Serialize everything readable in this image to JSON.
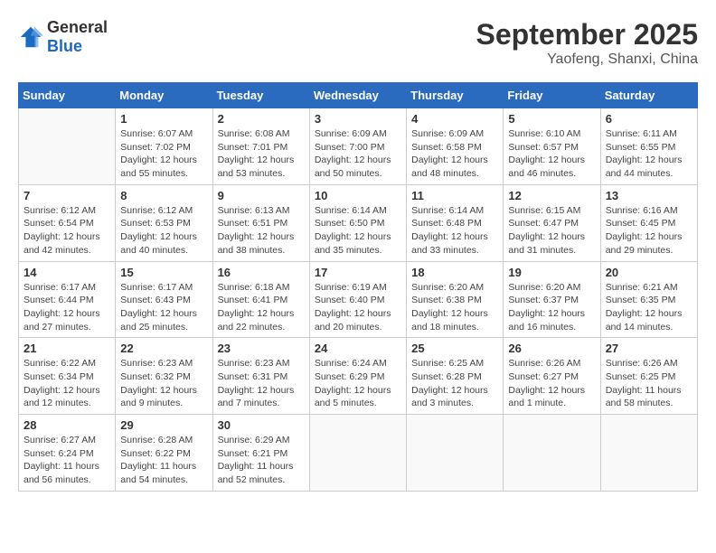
{
  "header": {
    "logo_general": "General",
    "logo_blue": "Blue",
    "month_title": "September 2025",
    "location": "Yaofeng, Shanxi, China"
  },
  "days_of_week": [
    "Sunday",
    "Monday",
    "Tuesday",
    "Wednesday",
    "Thursday",
    "Friday",
    "Saturday"
  ],
  "weeks": [
    [
      {
        "day": "",
        "info": ""
      },
      {
        "day": "1",
        "info": "Sunrise: 6:07 AM\nSunset: 7:02 PM\nDaylight: 12 hours\nand 55 minutes."
      },
      {
        "day": "2",
        "info": "Sunrise: 6:08 AM\nSunset: 7:01 PM\nDaylight: 12 hours\nand 53 minutes."
      },
      {
        "day": "3",
        "info": "Sunrise: 6:09 AM\nSunset: 7:00 PM\nDaylight: 12 hours\nand 50 minutes."
      },
      {
        "day": "4",
        "info": "Sunrise: 6:09 AM\nSunset: 6:58 PM\nDaylight: 12 hours\nand 48 minutes."
      },
      {
        "day": "5",
        "info": "Sunrise: 6:10 AM\nSunset: 6:57 PM\nDaylight: 12 hours\nand 46 minutes."
      },
      {
        "day": "6",
        "info": "Sunrise: 6:11 AM\nSunset: 6:55 PM\nDaylight: 12 hours\nand 44 minutes."
      }
    ],
    [
      {
        "day": "7",
        "info": "Sunrise: 6:12 AM\nSunset: 6:54 PM\nDaylight: 12 hours\nand 42 minutes."
      },
      {
        "day": "8",
        "info": "Sunrise: 6:12 AM\nSunset: 6:53 PM\nDaylight: 12 hours\nand 40 minutes."
      },
      {
        "day": "9",
        "info": "Sunrise: 6:13 AM\nSunset: 6:51 PM\nDaylight: 12 hours\nand 38 minutes."
      },
      {
        "day": "10",
        "info": "Sunrise: 6:14 AM\nSunset: 6:50 PM\nDaylight: 12 hours\nand 35 minutes."
      },
      {
        "day": "11",
        "info": "Sunrise: 6:14 AM\nSunset: 6:48 PM\nDaylight: 12 hours\nand 33 minutes."
      },
      {
        "day": "12",
        "info": "Sunrise: 6:15 AM\nSunset: 6:47 PM\nDaylight: 12 hours\nand 31 minutes."
      },
      {
        "day": "13",
        "info": "Sunrise: 6:16 AM\nSunset: 6:45 PM\nDaylight: 12 hours\nand 29 minutes."
      }
    ],
    [
      {
        "day": "14",
        "info": "Sunrise: 6:17 AM\nSunset: 6:44 PM\nDaylight: 12 hours\nand 27 minutes."
      },
      {
        "day": "15",
        "info": "Sunrise: 6:17 AM\nSunset: 6:43 PM\nDaylight: 12 hours\nand 25 minutes."
      },
      {
        "day": "16",
        "info": "Sunrise: 6:18 AM\nSunset: 6:41 PM\nDaylight: 12 hours\nand 22 minutes."
      },
      {
        "day": "17",
        "info": "Sunrise: 6:19 AM\nSunset: 6:40 PM\nDaylight: 12 hours\nand 20 minutes."
      },
      {
        "day": "18",
        "info": "Sunrise: 6:20 AM\nSunset: 6:38 PM\nDaylight: 12 hours\nand 18 minutes."
      },
      {
        "day": "19",
        "info": "Sunrise: 6:20 AM\nSunset: 6:37 PM\nDaylight: 12 hours\nand 16 minutes."
      },
      {
        "day": "20",
        "info": "Sunrise: 6:21 AM\nSunset: 6:35 PM\nDaylight: 12 hours\nand 14 minutes."
      }
    ],
    [
      {
        "day": "21",
        "info": "Sunrise: 6:22 AM\nSunset: 6:34 PM\nDaylight: 12 hours\nand 12 minutes."
      },
      {
        "day": "22",
        "info": "Sunrise: 6:23 AM\nSunset: 6:32 PM\nDaylight: 12 hours\nand 9 minutes."
      },
      {
        "day": "23",
        "info": "Sunrise: 6:23 AM\nSunset: 6:31 PM\nDaylight: 12 hours\nand 7 minutes."
      },
      {
        "day": "24",
        "info": "Sunrise: 6:24 AM\nSunset: 6:29 PM\nDaylight: 12 hours\nand 5 minutes."
      },
      {
        "day": "25",
        "info": "Sunrise: 6:25 AM\nSunset: 6:28 PM\nDaylight: 12 hours\nand 3 minutes."
      },
      {
        "day": "26",
        "info": "Sunrise: 6:26 AM\nSunset: 6:27 PM\nDaylight: 12 hours\nand 1 minute."
      },
      {
        "day": "27",
        "info": "Sunrise: 6:26 AM\nSunset: 6:25 PM\nDaylight: 11 hours\nand 58 minutes."
      }
    ],
    [
      {
        "day": "28",
        "info": "Sunrise: 6:27 AM\nSunset: 6:24 PM\nDaylight: 11 hours\nand 56 minutes."
      },
      {
        "day": "29",
        "info": "Sunrise: 6:28 AM\nSunset: 6:22 PM\nDaylight: 11 hours\nand 54 minutes."
      },
      {
        "day": "30",
        "info": "Sunrise: 6:29 AM\nSunset: 6:21 PM\nDaylight: 11 hours\nand 52 minutes."
      },
      {
        "day": "",
        "info": ""
      },
      {
        "day": "",
        "info": ""
      },
      {
        "day": "",
        "info": ""
      },
      {
        "day": "",
        "info": ""
      }
    ]
  ]
}
